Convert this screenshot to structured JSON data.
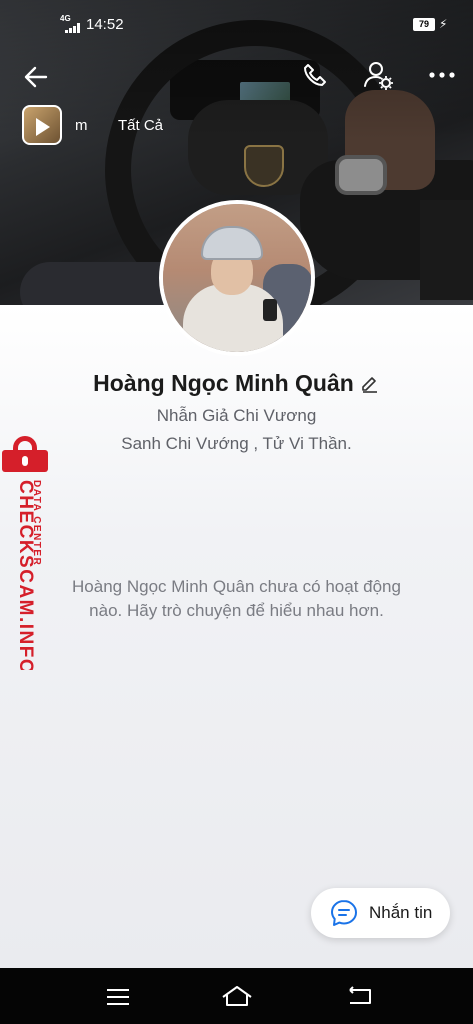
{
  "status_bar": {
    "network": "4G",
    "time": "14:52",
    "battery": "79"
  },
  "story": {
    "partial_label": "m",
    "all_label": "Tất Cả"
  },
  "profile": {
    "name": "Hoàng Ngọc Minh Quân",
    "bio_line1": "Nhẫn Giả Chi Vương",
    "bio_line2": "Sanh Chi Vướng , Tử Vi Thần."
  },
  "activity": {
    "empty_message": "Hoàng Ngọc Minh Quân chưa có hoạt động nào. Hãy trò chuyện để hiểu nhau hơn."
  },
  "actions": {
    "message_label": "Nhắn tin"
  },
  "watermark": {
    "line1": "DATA CENTER",
    "line2": "CHECKSCAM.INFO"
  },
  "icons": {
    "back": "arrow-left-icon",
    "call": "phone-icon",
    "user_settings": "user-gear-icon",
    "more": "more-dots-icon",
    "edit": "pencil-icon",
    "message": "chat-bubble-icon"
  },
  "colors": {
    "watermark_red": "#d51f2a",
    "message_icon_blue": "#1a73e8"
  }
}
